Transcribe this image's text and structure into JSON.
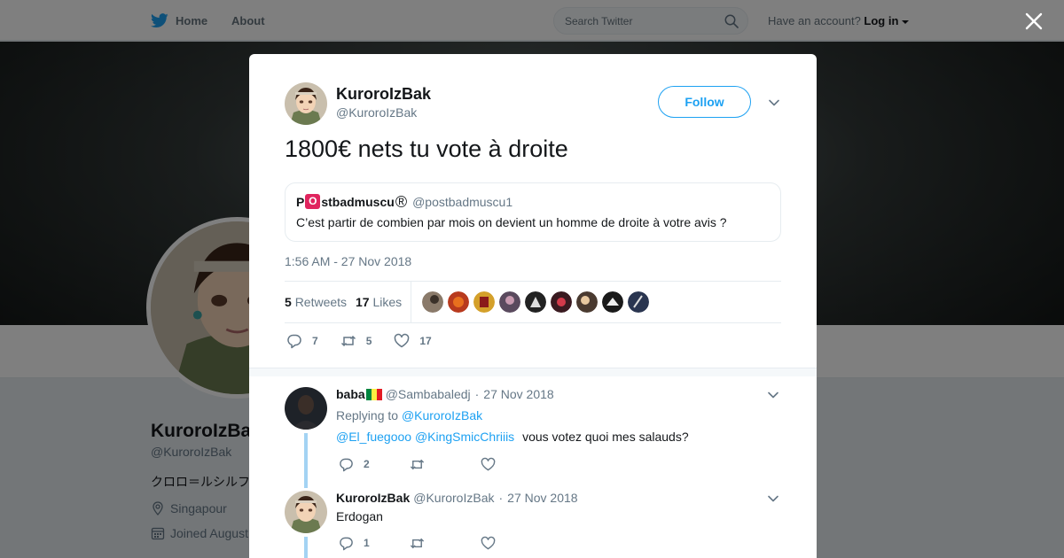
{
  "colors": {
    "twitter_blue": "#1da1f2",
    "gray_text": "#657786",
    "heart_pink": "#e0245e"
  },
  "nav": {
    "home_label": "Home",
    "about_label": "About"
  },
  "search": {
    "placeholder": "Search Twitter"
  },
  "account": {
    "prompt": "Have an account?",
    "login_label": "Log in"
  },
  "profile": {
    "name": "KuroroIzBak",
    "handle": "@KuroroIzBak",
    "bio": "クロロ＝ルシルフ",
    "location": "Singapour",
    "joined": "Joined August"
  },
  "tweet": {
    "author_name": "KuroroIzBak",
    "author_handle": "@KuroroIzBak",
    "follow_label": "Follow",
    "text": "1800€ nets tu vote à droite",
    "quote": {
      "name_prefix": "P",
      "name_badge": "O",
      "name_suffix": "stbadmuscu",
      "name_reg": "®",
      "handle": "@postbadmuscu1",
      "text": "C’est partir de combien par mois on devient un homme de droite à votre avis ?"
    },
    "timestamp": "1:56 AM - 27 Nov 2018",
    "retweets_count": "5",
    "retweets_label": "Retweets",
    "likes_count": "17",
    "likes_label": "Likes",
    "liker_icons": [
      "liker-avatar",
      "liker-avatar",
      "liker-avatar",
      "liker-avatar",
      "liker-avatar",
      "liker-avatar",
      "liker-avatar",
      "liker-avatar",
      "liker-avatar"
    ],
    "actions": {
      "reply_count": "7",
      "retweet_count": "5",
      "like_count": "17"
    }
  },
  "replies": [
    {
      "name": "baba",
      "handle": "@Sambabaledj",
      "dot": "·",
      "date": "27 Nov 2018",
      "replying_prefix": "Replying to",
      "replying_to": "@KuroroIzBak",
      "mention1": "@El_fuegooo",
      "mention2": "@KingSmicChriiis",
      "text": "vous votez quoi mes salauds?",
      "reply_count": "2",
      "retweet_count": "",
      "like_count": ""
    },
    {
      "name": "KuroroIzBak",
      "handle": "@KuroroIzBak",
      "dot": "·",
      "date": "27 Nov 2018",
      "text": "Erdogan",
      "reply_count": "1",
      "retweet_count": "",
      "like_count": ""
    }
  ]
}
